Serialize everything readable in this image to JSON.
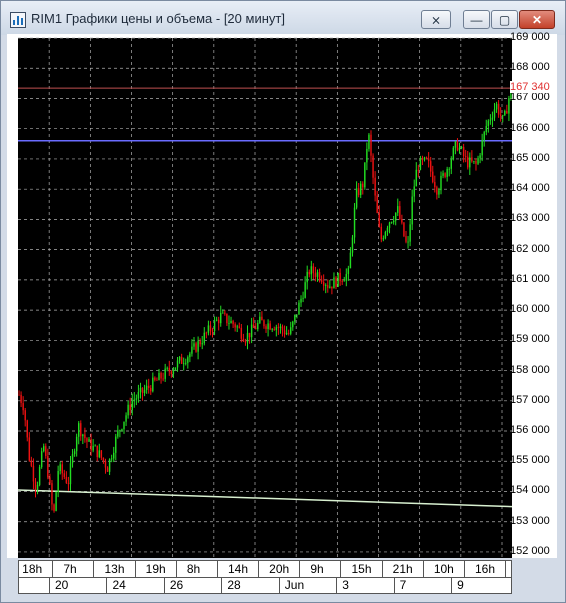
{
  "window": {
    "title": "RIM1 Графики цены и объема - [20 минут]",
    "buttons": {
      "pin": "⨯",
      "minimize": "—",
      "maximize": "▢",
      "close": "✕"
    }
  },
  "colors": {
    "background": "#000000",
    "grid": "#b0b0b0",
    "up_candle": "#22dd22",
    "down_candle": "#ee1111",
    "resistance_line": "#6a6cff",
    "last_price_line": "#c05050",
    "trend_line": "#d8f0d0"
  },
  "chart_data": {
    "type": "candlestick",
    "title": "RIM1 Графики цены и объема - [20 минут]",
    "y_axis": {
      "ticks": [
        "169 000",
        "168 000",
        "167 000",
        "166 000",
        "165 000",
        "164 000",
        "163 000",
        "162 000",
        "161 000",
        "160 000",
        "159 000",
        "158 000",
        "157 000",
        "156 000",
        "155 000",
        "154 000",
        "153 000",
        "152 000"
      ],
      "tick_values": [
        169000,
        168000,
        167000,
        166000,
        165000,
        164000,
        163000,
        162000,
        161000,
        160000,
        159000,
        158000,
        157000,
        156000,
        155000,
        154000,
        153000,
        152000
      ],
      "range": [
        151800,
        169000
      ]
    },
    "last_price": {
      "label": "167 340",
      "value": 167340
    },
    "horizontal_line": {
      "value": 165600,
      "color_name": "blue"
    },
    "trend_line": {
      "start_value": 154050,
      "end_value": 153500
    },
    "x_axis_top": [
      "18h",
      "7h",
      "13h",
      "19h",
      "8h",
      "14h",
      "20h",
      "9h",
      "15h",
      "21h",
      "10h",
      "16h"
    ],
    "x_axis_bottom": [
      "20",
      "24",
      "26",
      "28",
      "Jun",
      "3",
      "7",
      "9"
    ],
    "price_path": [
      [
        0,
        157200
      ],
      [
        0.01,
        156800
      ],
      [
        0.02,
        155200
      ],
      [
        0.035,
        154100
      ],
      [
        0.05,
        155500
      ],
      [
        0.06,
        154500
      ],
      [
        0.07,
        153100
      ],
      [
        0.08,
        154800
      ],
      [
        0.1,
        154300
      ],
      [
        0.12,
        156200
      ],
      [
        0.14,
        155600
      ],
      [
        0.16,
        155300
      ],
      [
        0.18,
        154800
      ],
      [
        0.2,
        155900
      ],
      [
        0.23,
        157000
      ],
      [
        0.26,
        157400
      ],
      [
        0.29,
        157800
      ],
      [
        0.32,
        158200
      ],
      [
        0.35,
        158600
      ],
      [
        0.38,
        159200
      ],
      [
        0.41,
        159800
      ],
      [
        0.44,
        159500
      ],
      [
        0.46,
        159100
      ],
      [
        0.49,
        159600
      ],
      [
        0.52,
        159500
      ],
      [
        0.55,
        159200
      ],
      [
        0.57,
        160200
      ],
      [
        0.59,
        161300
      ],
      [
        0.61,
        161200
      ],
      [
        0.63,
        160800
      ],
      [
        0.655,
        161100
      ],
      [
        0.67,
        161200
      ],
      [
        0.685,
        163800
      ],
      [
        0.7,
        164200
      ],
      [
        0.71,
        165900
      ],
      [
        0.725,
        163500
      ],
      [
        0.735,
        162300
      ],
      [
        0.75,
        162900
      ],
      [
        0.77,
        163300
      ],
      [
        0.78,
        162600
      ],
      [
        0.79,
        162000
      ],
      [
        0.8,
        163800
      ],
      [
        0.81,
        164800
      ],
      [
        0.83,
        164900
      ],
      [
        0.85,
        164000
      ],
      [
        0.87,
        164700
      ],
      [
        0.89,
        165500
      ],
      [
        0.91,
        164900
      ],
      [
        0.93,
        164800
      ],
      [
        0.95,
        166100
      ],
      [
        0.97,
        166800
      ],
      [
        0.985,
        166200
      ],
      [
        1,
        167340
      ]
    ]
  },
  "status": {
    "text": ""
  }
}
